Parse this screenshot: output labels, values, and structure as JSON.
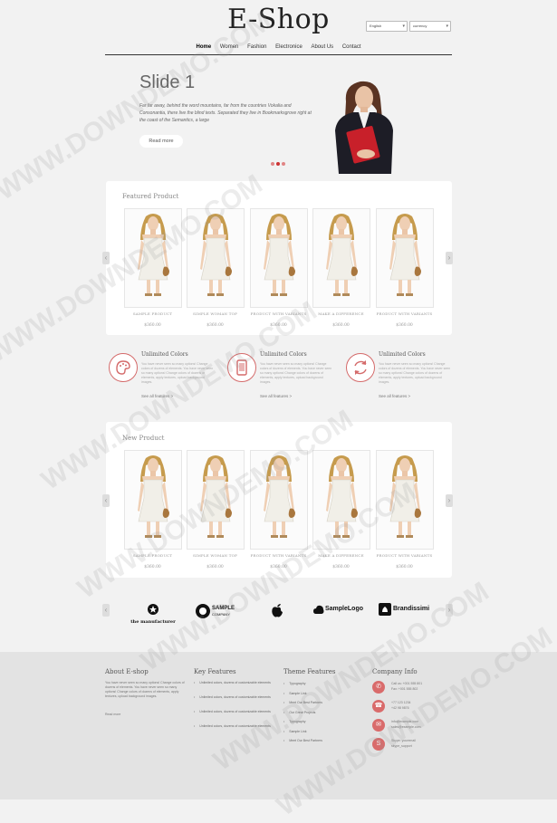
{
  "header": {
    "logo": "E-Shop",
    "language": "English",
    "currency": "currency",
    "nav": [
      "Home",
      "Women",
      "Fashion",
      "Electronice",
      "About Us",
      "Contact"
    ]
  },
  "slider": {
    "title": "Slide 1",
    "text": "Far far away, behind the word mountains, far from the countries Vokalia and Consonantia, there live the blind texts. Separated they live in Bookmarksgrove right at the coast of the Semantics, a large",
    "button": "Read more"
  },
  "featured": {
    "title": "Featured Product",
    "products": [
      {
        "name": "SAMPLE PRODUCT",
        "price": "$360.00"
      },
      {
        "name": "SIMPLE WOMAN TOP",
        "price": "$360.00"
      },
      {
        "name": "PRODUCT WITH VARIANTS",
        "price": "$360.00"
      },
      {
        "name": "MAKE A DIFFERENCE",
        "price": "$360.00"
      },
      {
        "name": "PRODUCT WITH VARIANTS",
        "price": "$360.00"
      }
    ]
  },
  "features": [
    {
      "title": "Unlimited Colors",
      "text": "You have never seen so many options! Change colors of dozens of elements. You have never seen so many options! Change colors of dozens of elements, apply textures, upload background images.",
      "more": "See all features >"
    },
    {
      "title": "Unlimited Colors",
      "text": "You have never seen so many options! Change colors of dozens of elements. You have never seen so many options! Change colors of dozens of elements, apply textures, upload background images.",
      "more": "See all features >"
    },
    {
      "title": "Unlimited Colors",
      "text": "You have never seen so many options! Change colors of dozens of elements. You have never seen so many options! Change colors of dozens of elements, apply textures, upload background images.",
      "more": "See all features >"
    }
  ],
  "new_products": {
    "title": "New Product",
    "products": [
      {
        "name": "SAMPLE PRODUCT",
        "price": "$360.00"
      },
      {
        "name": "SIMPLE WOMAN TOP",
        "price": "$360.00"
      },
      {
        "name": "PRODUCT WITH VARIANTS",
        "price": "$360.00"
      },
      {
        "name": "MAKE A DIFFERENCE",
        "price": "$360.00"
      },
      {
        "name": "PRODUCT WITH VARIANTS",
        "price": "$360.00"
      }
    ]
  },
  "brands": [
    "the manufacturer",
    "SAMPLE",
    "COMPANY",
    "SampleLogo",
    "Brandissimi"
  ],
  "footer": {
    "about": {
      "title": "About E-shop",
      "text": "You have never seen so many options! Change colors of dozens of elements. You have never seen so many options! Change colors of dozens of elements, apply textures, upload background images.",
      "more": "Read more"
    },
    "key_features": {
      "title": "Key Features",
      "items": [
        "Unlimited colors, dozens of customizable elements",
        "Unlimited colors, dozens of customizable elements",
        "Unlimited colors, dozens of customizable elements",
        "Unlimited colors, dozens of customizable elements"
      ]
    },
    "theme_features": {
      "title": "Theme Features",
      "items": [
        "Typography",
        "Sample Link",
        "Meet Our Best Partners",
        "Our Great Projects",
        "Typography",
        "Sample Link",
        "Meet Our Best Partners"
      ]
    },
    "company": {
      "title": "Company Info",
      "rows": [
        [
          "Call us: +001 555 801",
          "Fax: +001 555 802"
        ],
        [
          "+77 123 1234",
          "+42 98 9876"
        ],
        [
          "info@example.com",
          "sales@example.com"
        ],
        [
          "Skype: youremail",
          "skype_support"
        ]
      ]
    }
  },
  "watermark": "WWW.DOWNDEMO.COM",
  "colors": {
    "accent": "#d96b6b",
    "background": "#f2f2f2",
    "footer": "#e3e3e3"
  }
}
